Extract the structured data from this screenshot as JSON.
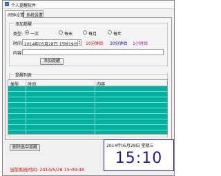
{
  "window": {
    "title": "个人提醒软件"
  },
  "tabs": [
    {
      "label": "闹钟设置",
      "active": true
    },
    {
      "label": "系统设置",
      "active": false
    }
  ],
  "add_group": {
    "legend": "添加提醒",
    "type_label": "类型:",
    "types": [
      {
        "label": "一次",
        "selected": true
      },
      {
        "label": "每天",
        "selected": false
      },
      {
        "label": "每月",
        "selected": false
      },
      {
        "label": "每年",
        "selected": false
      }
    ],
    "time_label": "时间:",
    "time_value": "2014年05月28日 15时19分",
    "quick_times": [
      {
        "label": "10分钟后",
        "color": "#e00000"
      },
      {
        "label": "30分钟后",
        "color": "#1010c0"
      },
      {
        "label": "1小时后",
        "color": "#b000b0"
      }
    ],
    "content_label": "内容:",
    "content_value": "",
    "add_button": "添加提醒"
  },
  "list_group": {
    "legend": "提醒列表",
    "columns": [
      "类型",
      "时间",
      "内容"
    ],
    "rows": []
  },
  "delete_button": "删除选中提醒",
  "clock": {
    "date": "2014年05月28日  星期三",
    "time": "15:10"
  },
  "status": "当前系统时间: 2014/5/28 15:09:48",
  "colors": {
    "table_bg": "#00b0a0",
    "clock": "#1a1a9a",
    "status": "#e00000"
  }
}
